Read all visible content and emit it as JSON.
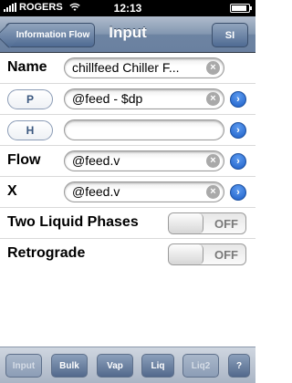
{
  "status_bar": {
    "carrier": "ROGERS",
    "time": "12:13",
    "battery_level": 0.9
  },
  "nav": {
    "back_label": "Information Flow",
    "title": "Input",
    "units_label": "SI"
  },
  "rows": {
    "name": {
      "label": "Name",
      "value": "chillfeed Chiller F..."
    },
    "p": {
      "button": "P",
      "value": "@feed - $dp"
    },
    "h": {
      "button": "H",
      "value": ""
    },
    "flow": {
      "label": "Flow",
      "value": "@feed.v"
    },
    "x": {
      "label": "X",
      "value": "@feed.v"
    },
    "two_phase": {
      "label": "Two Liquid Phases",
      "state": "OFF"
    },
    "retrograde": {
      "label": "Retrograde",
      "state": "OFF"
    }
  },
  "icons": {
    "clear": "×",
    "disclosure": "›"
  },
  "tabs": [
    {
      "label": "Input",
      "enabled": false
    },
    {
      "label": "Bulk",
      "enabled": true
    },
    {
      "label": "Vap",
      "enabled": true
    },
    {
      "label": "Liq",
      "enabled": true
    },
    {
      "label": "Liq2",
      "enabled": false
    },
    {
      "label": "?",
      "enabled": true
    }
  ]
}
